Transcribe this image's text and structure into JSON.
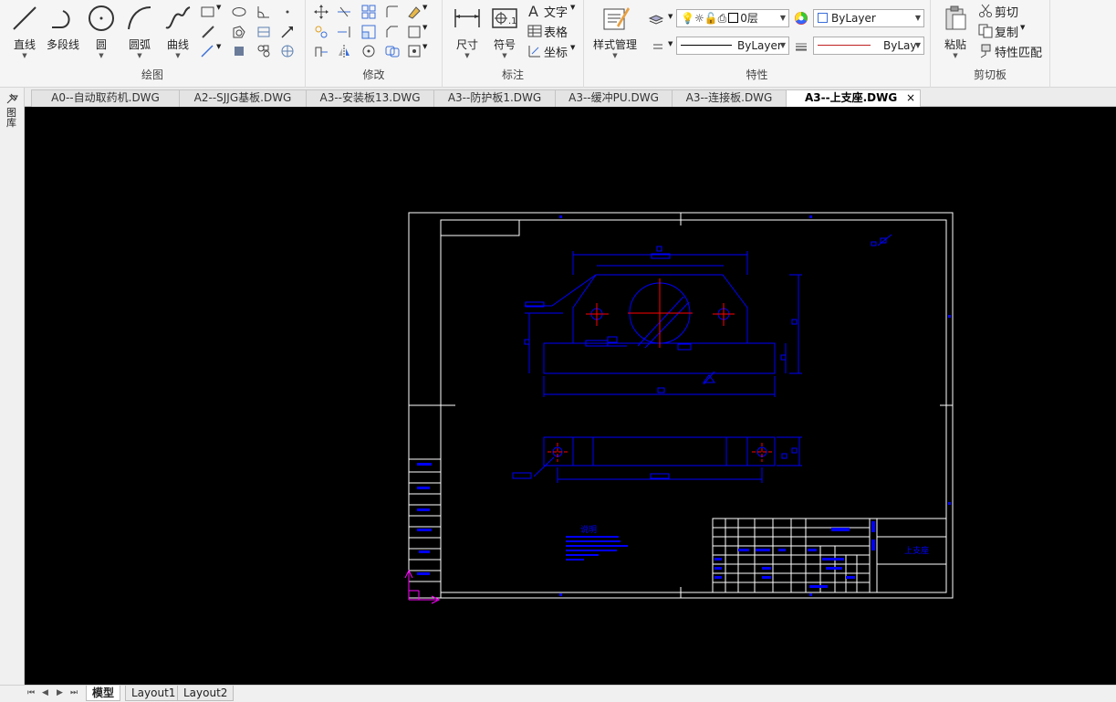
{
  "ribbon": {
    "draw": {
      "title": "绘图",
      "line": "直线",
      "polyline": "多段线",
      "circle": "圆",
      "arc": "圆弧",
      "spline": "曲线"
    },
    "modify": {
      "title": "修改"
    },
    "annotate": {
      "title": "标注",
      "dimension": "尺寸",
      "symbol": "符号",
      "text": "文字",
      "table": "表格",
      "coord": "坐标"
    },
    "properties": {
      "title": "特性",
      "style_manager": "样式管理",
      "layer_value": "0层",
      "color_value": "ByLayer",
      "linetype_value": "ByLayer",
      "lineweight_value": "ByLay"
    },
    "clipboard": {
      "title": "剪切板",
      "paste": "粘贴",
      "cut": "剪切",
      "copy": "复制",
      "match": "特性匹配"
    }
  },
  "left_strip": {
    "label": "图库"
  },
  "doc_tabs": [
    {
      "label": "A0--自动取药机.DWG"
    },
    {
      "label": "A2--SJJG基板.DWG"
    },
    {
      "label": "A3--安装板13.DWG"
    },
    {
      "label": "A3--防护板1.DWG"
    },
    {
      "label": "A3--缓冲PU.DWG"
    },
    {
      "label": "A3--连接板.DWG"
    },
    {
      "label": "A3--上支座.DWG"
    }
  ],
  "active_tab_index": 6,
  "layout_tabs": [
    {
      "label": "模型"
    },
    {
      "label": "Layout1"
    },
    {
      "label": "Layout2"
    }
  ],
  "drawing": {
    "title_block_name": "上支座",
    "note_title": "说明"
  },
  "colors": {
    "canvas": "#000000",
    "frame": "#ffffff",
    "geometry": "#0000ff",
    "centerline": "#ff0000",
    "ucs": "#ff00ff",
    "layer_bulb": "#f2d21b"
  }
}
